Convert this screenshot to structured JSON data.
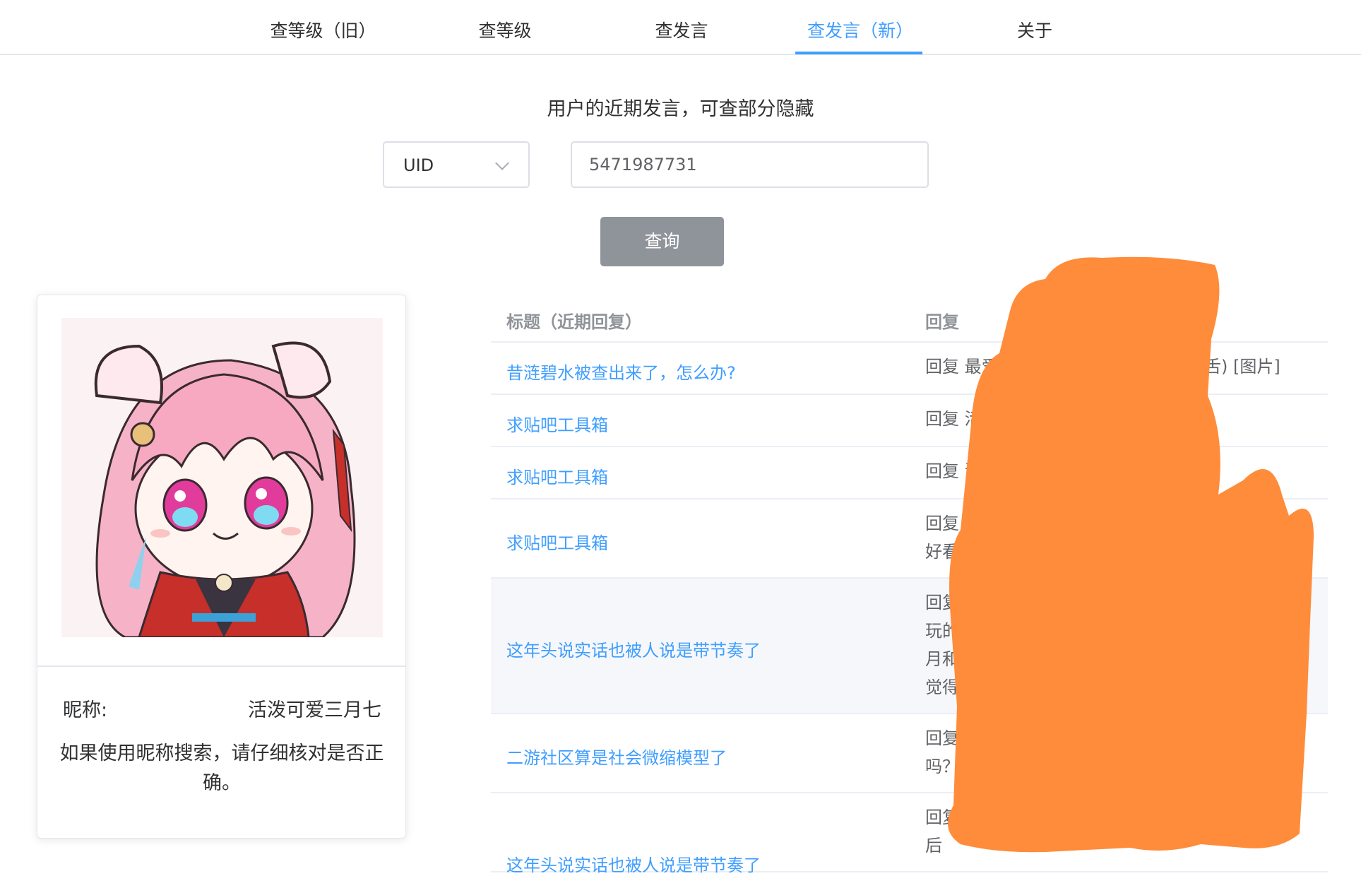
{
  "nav": {
    "tabs": [
      {
        "label": "查等级（旧）",
        "active": false
      },
      {
        "label": "查等级",
        "active": false
      },
      {
        "label": "查发言",
        "active": false
      },
      {
        "label": "查发言（新）",
        "active": true
      },
      {
        "label": "关于",
        "active": false
      }
    ]
  },
  "search": {
    "subtitle": "用户的近期发言，可查部分隐藏",
    "type_selected": "UID",
    "input_value": "5471987731",
    "button_label": "查询"
  },
  "profile": {
    "nickname_label": "昵称:",
    "nickname_value": "活泼可爱三月七",
    "note": "如果使用昵称搜索，请仔细核对是否正确。"
  },
  "table": {
    "headers": [
      "标题（近期回复）",
      "回复"
    ],
    "rows": [
      {
        "title": "昔涟碧水被查出来了，怎么办?",
        "reply": "回复 最爱三",
        "reply_tail": "舌) [图片]"
      },
      {
        "title": "求贴吧工具箱",
        "reply": "回复 活泼可"
      },
      {
        "title": "求贴吧工具箱",
        "reply": "回复 活泼可"
      },
      {
        "title": "求贴吧工具箱",
        "reply": "回复 活泼可\n好看"
      },
      {
        "title": "这年头说实话也被人说是带节奏了",
        "reply": "回复\n玩的\n月和\n觉得"
      },
      {
        "title": "二游社区算是社会微缩模型了",
        "reply": "回复\n吗？"
      },
      {
        "title": "这年头说实话也被人说是带节奏了",
        "reply": "回复 活\n后"
      }
    ]
  },
  "colors": {
    "accent": "#409eff",
    "button": "#8f939a",
    "scribble": "#ff8c3a"
  }
}
